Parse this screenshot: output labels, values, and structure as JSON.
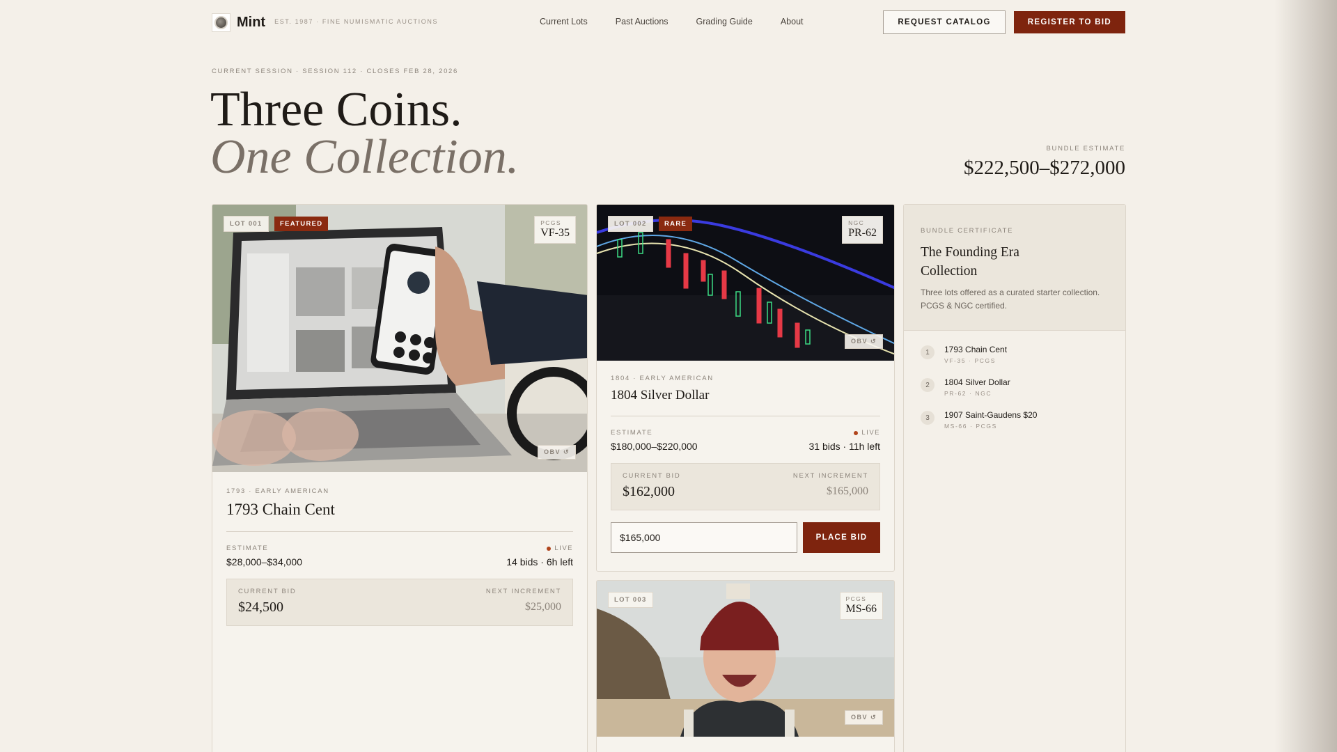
{
  "brand": {
    "name": "Mint",
    "tagline": "EST. 1987 · FINE NUMISMATIC AUCTIONS"
  },
  "nav": {
    "links": [
      "Current Lots",
      "Past Auctions",
      "Grading Guide",
      "About"
    ]
  },
  "actions": {
    "catalog": "REQUEST CATALOG",
    "register": "REGISTER TO BID"
  },
  "hero": {
    "session": "CURRENT SESSION · SESSION 112 · CLOSES FEB 28, 2026",
    "title_1": "Three Coins.",
    "title_2": "One Collection.",
    "bundle_label": "BUNDLE ESTIMATE",
    "bundle_value": "$222,500–$272,000"
  },
  "lots": [
    {
      "lot": "LOT 001",
      "tag": "FEATURED",
      "grade_service": "PCGS",
      "grade": "VF-35",
      "obv": "OBV ↺",
      "eyebrow": "1793 · EARLY AMERICAN",
      "title": "1793 Chain Cent",
      "estimate_label": "ESTIMATE",
      "estimate": "$28,000–$34,000",
      "live": "LIVE",
      "activity": "14 bids · 6h left",
      "current_bid_label": "CURRENT BID",
      "current_bid": "$24,500",
      "next_increment_label": "NEXT INCREMENT",
      "next_increment": "$25,000"
    },
    {
      "lot": "LOT 002",
      "tag": "RARE",
      "grade_service": "NGC",
      "grade": "PR-62",
      "obv": "OBV ↺",
      "eyebrow": "1804 · EARLY AMERICAN",
      "title": "1804 Silver Dollar",
      "estimate_label": "ESTIMATE",
      "estimate": "$180,000–$220,000",
      "live": "LIVE",
      "activity": "31 bids · 11h left",
      "current_bid_label": "CURRENT BID",
      "current_bid": "$162,000",
      "next_increment_label": "NEXT INCREMENT",
      "next_increment": "$165,000",
      "bid_input": "$165,000",
      "place_bid": "PLACE BID"
    },
    {
      "lot": "LOT 003",
      "grade_service": "PCGS",
      "grade": "MS-66",
      "obv": "OBV ↺"
    }
  ],
  "bundle": {
    "eyebrow": "BUNDLE CERTIFICATE",
    "title": "The Founding Era Collection",
    "description": "Three lots offered as a curated starter collection. PCGS & NGC certified.",
    "items": [
      {
        "num": "1",
        "name": "1793 Chain Cent",
        "grade": "VF-35 · PCGS"
      },
      {
        "num": "2",
        "name": "1804 Silver Dollar",
        "grade": "PR-62 · NGC"
      },
      {
        "num": "3",
        "name": "1907 Saint-Gaudens $20",
        "grade": "MS-66 · PCGS"
      }
    ]
  },
  "colors": {
    "background": "#f4f0e9",
    "accent": "#7e240e",
    "live_dot": "#b0441c"
  }
}
